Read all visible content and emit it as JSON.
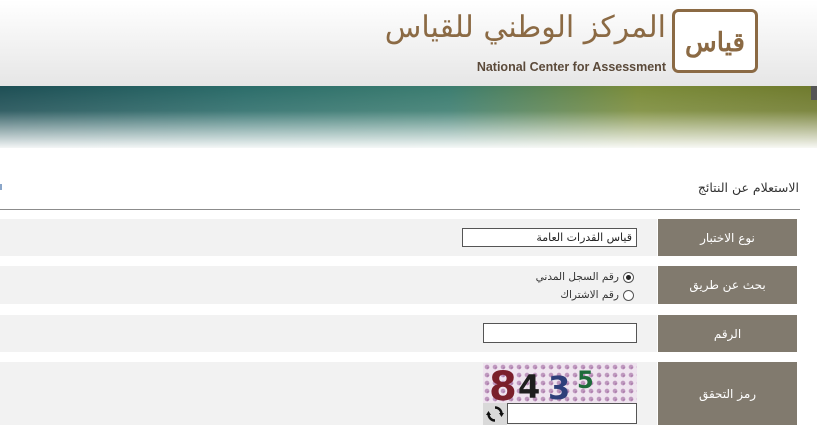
{
  "header": {
    "logo_arabic": "المركز الوطني للقياس",
    "logo_english": "National Center for Assessment",
    "logo_mark_text": "قياس",
    "logo_mark_icon": "qiyas-logo-icon"
  },
  "page": {
    "title": "الاستعلام عن النتائج"
  },
  "form": {
    "test_type": {
      "label": "نوع الاختبار",
      "value": "قياس القدرات العامة"
    },
    "search_by": {
      "label": "بحث عن طريق",
      "options": [
        {
          "label": "رقم السجل المدني",
          "selected": true
        },
        {
          "label": "رقم الاشتراك",
          "selected": false
        }
      ]
    },
    "number": {
      "label": "الرقم",
      "value": ""
    },
    "captcha": {
      "label": "رمز التحقق",
      "digits": [
        "8",
        "4",
        "3",
        "5"
      ],
      "digit_colors": [
        "#7a1f2a",
        "#1e1e1e",
        "#2e3f7a",
        "#1e6b3a"
      ],
      "input_value": "",
      "refresh_icon": "refresh-icon"
    }
  },
  "colors": {
    "label_bg": "#817a6e",
    "row_bg": "#f2f2f2",
    "brand_brown": "#8b6a44"
  }
}
